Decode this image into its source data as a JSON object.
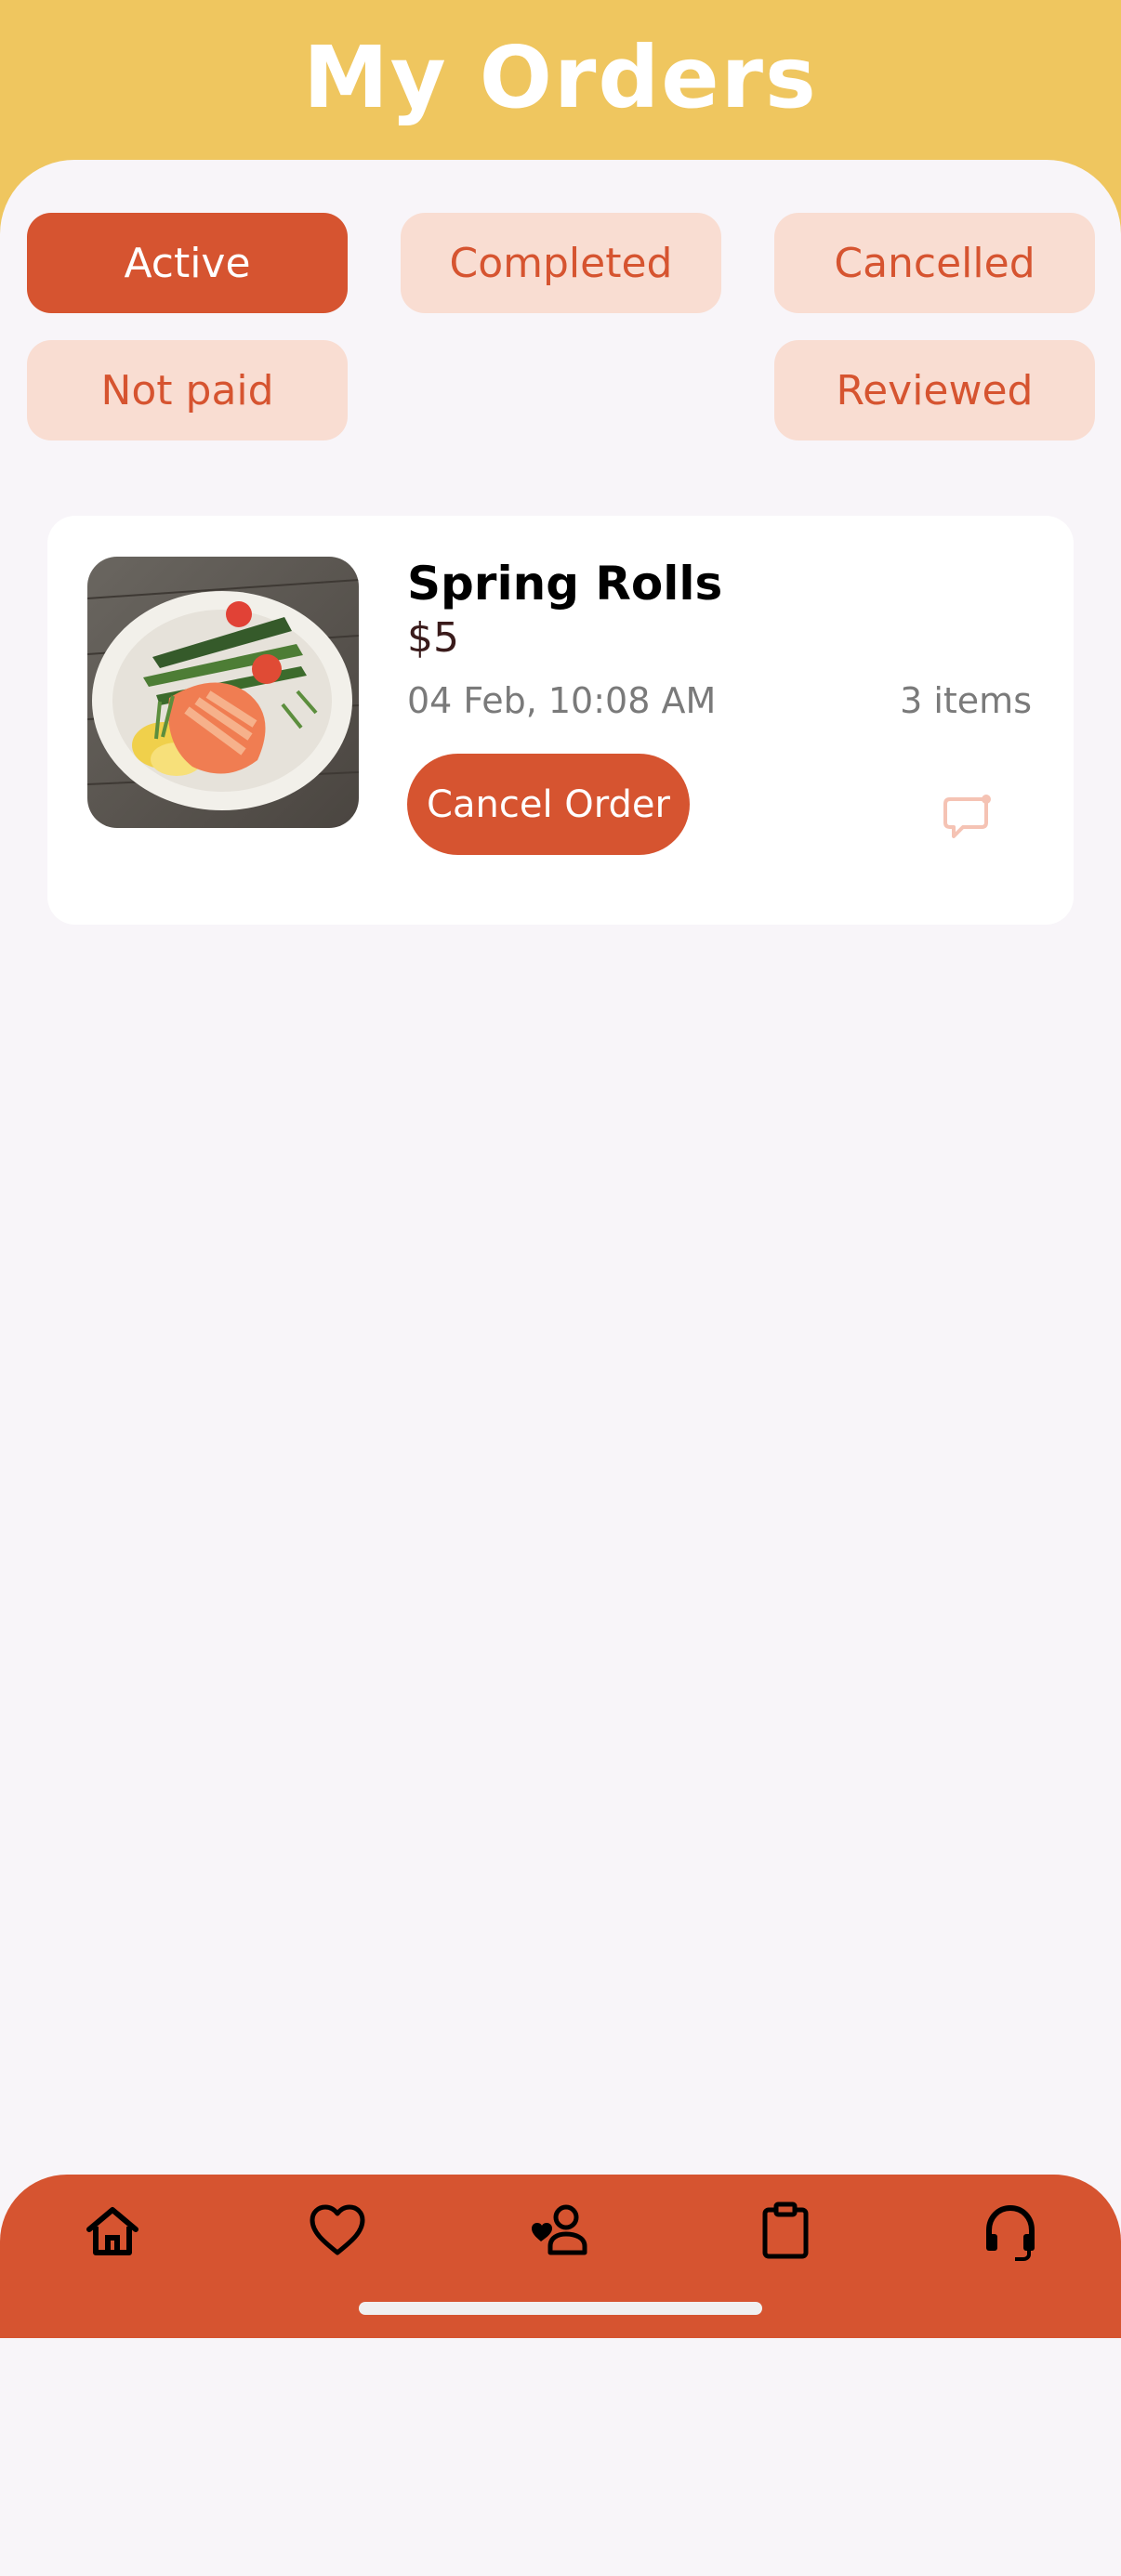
{
  "header": {
    "title": "My Orders"
  },
  "tabs": [
    {
      "label": "Active",
      "selected": true
    },
    {
      "label": "Completed",
      "selected": false
    },
    {
      "label": "Cancelled",
      "selected": false
    },
    {
      "label": "Not paid",
      "selected": false
    },
    {
      "label": "Reviewed",
      "selected": false
    }
  ],
  "orders": [
    {
      "name": "Spring Rolls",
      "price": "$5",
      "date": "04 Feb, 10:08 AM",
      "items": "3 items",
      "cancel_label": "Cancel Order",
      "image_icon": "salmon-plate",
      "chat_icon": "chat-icon"
    }
  ],
  "bottom_nav": [
    {
      "icon": "home-icon"
    },
    {
      "icon": "heart-icon"
    },
    {
      "icon": "person-favorite-icon"
    },
    {
      "icon": "clipboard-icon"
    },
    {
      "icon": "headset-icon"
    }
  ],
  "colors": {
    "header_bg": "#EFC65F",
    "accent": "#D65430",
    "tab_inactive_bg": "#F9DDD2",
    "content_bg": "#F8F5F9"
  }
}
